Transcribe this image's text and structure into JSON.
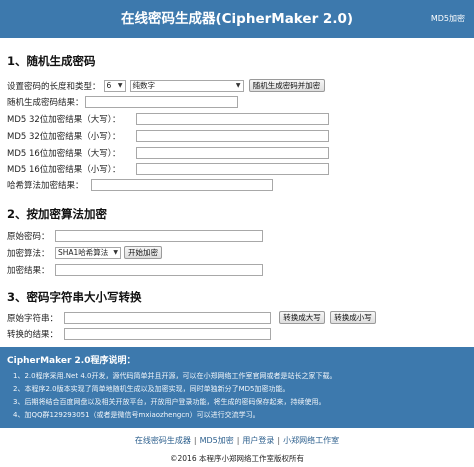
{
  "header": {
    "title": "在线密码生成器(CipherMaker 2.0)",
    "md5_link": "MD5加密"
  },
  "section1": {
    "title": "1、随机生成密码",
    "settings_label": "设置密码的长度和类型：",
    "length_value": "6",
    "type_value": "纯数字",
    "generate_button": "随机生成密码并加密",
    "result_label": "随机生成密码结果：",
    "md5_32_upper_label": "MD5 32位加密结果（大写）：",
    "md5_32_lower_label": "MD5 32位加密结果（小写）：",
    "md5_16_upper_label": "MD5 16位加密结果（大写）：",
    "md5_16_lower_label": "MD5 16位加密结果（小写）：",
    "hash_label": "哈希算法加密结果：",
    "result_value": "",
    "md5_32_upper_value": "",
    "md5_32_lower_value": "",
    "md5_16_upper_value": "",
    "md5_16_lower_value": "",
    "hash_value": ""
  },
  "section2": {
    "title": "2、按加密算法加密",
    "original_label": "原始密码：",
    "original_value": "",
    "algorithm_label": "加密算法：",
    "algorithm_value": "SHA1哈希算法",
    "encrypt_button": "开始加密",
    "result_label": "加密结果：",
    "result_value": ""
  },
  "section3": {
    "title": "3、密码字符串大小写转换",
    "original_label": "原始字符串：",
    "original_value": "",
    "to_upper_button": "转换成大写",
    "to_lower_button": "转换成小写",
    "result_label": "转换的结果：",
    "result_value": ""
  },
  "info": {
    "title": "CipherMaker 2.0程序说明：",
    "notes": [
      "1、2.0程序采用.Net 4.0开发，源代码简单并且开源，可以在小郑网络工作室官网或者是站长之家下载。",
      "2、本程序2.0版本实现了简单地随机生成以及加密实现，同时单独新分了MD5加密功能。",
      "3、后期将结合百度网盘以及相关开放平台，开放用户登录功能，将生成的密码保存起来，持续使用。",
      "4、加QQ群129293051（或者是微信号mxiaozhengcn）可以进行交流学习。"
    ]
  },
  "footer": {
    "links": [
      "在线密码生成器",
      "MD5加密",
      "用户登录",
      "小郑网络工作室"
    ],
    "separator": "|",
    "copyright": "©2016 本程序小郑网络工作室版权所有"
  },
  "colors": {
    "header_bg": "#3d79ad",
    "info_bg": "#3d79ad",
    "link": "#2c5f8d"
  }
}
